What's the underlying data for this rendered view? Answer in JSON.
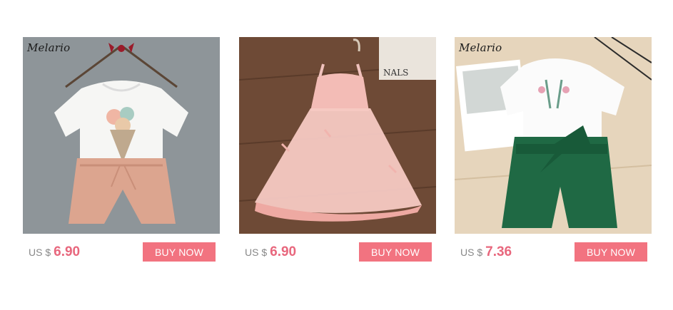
{
  "products": [
    {
      "brand": "Melario",
      "currency": "US $",
      "price": "6.90",
      "button_label": "BUY NOW"
    },
    {
      "brand": "",
      "sign_text": "NALS",
      "currency": "US $",
      "price": "6.90",
      "button_label": "BUY NOW"
    },
    {
      "brand": "Melario",
      "currency": "US $",
      "price": "7.36",
      "button_label": "BUY NOW"
    }
  ],
  "colors": {
    "price": "#e8677d",
    "button_bg": "#f27380",
    "currency": "#888888"
  }
}
